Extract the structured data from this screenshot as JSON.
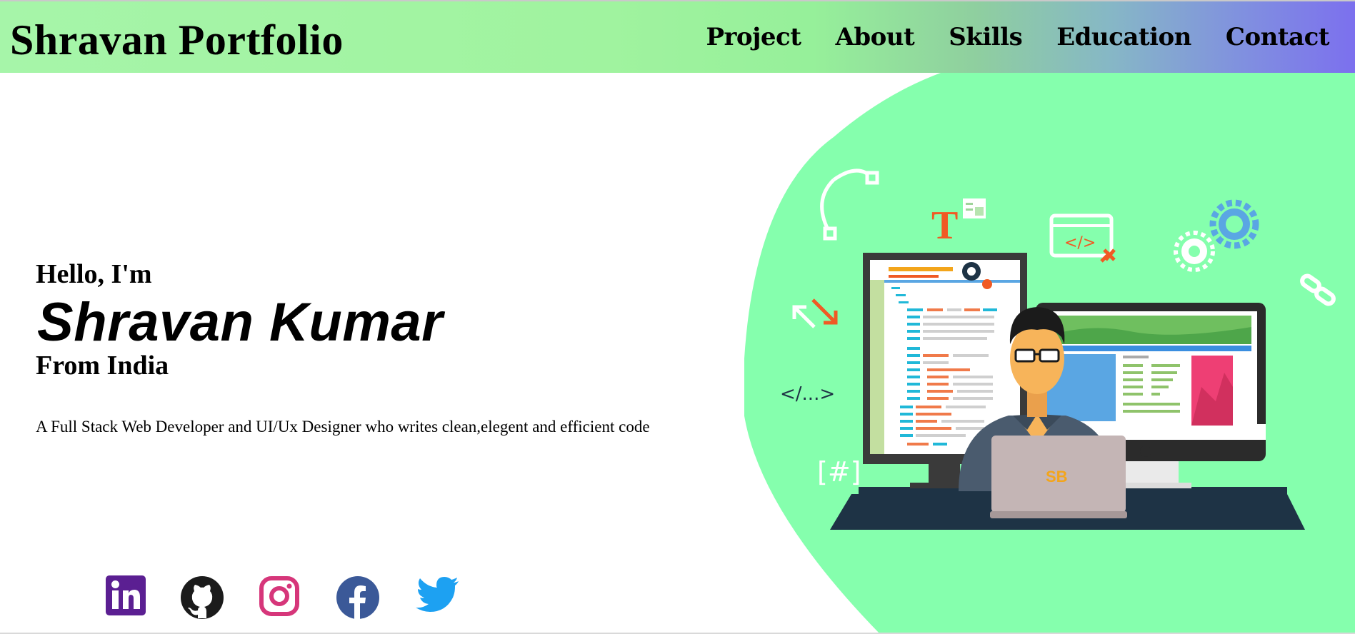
{
  "header": {
    "brand": "Shravan Portfolio",
    "nav": [
      "Project",
      "About",
      "Skills",
      "Education",
      "Contact"
    ]
  },
  "hero": {
    "greeting": "Hello, I'm",
    "name": "Shravan Kumar",
    "location": "From India",
    "description": "A Full Stack Web Developer and UI/Ux Designer who writes clean,elegent and efficient code",
    "illustration": {
      "code_tag": "</...>",
      "hash_tag": "[#]",
      "type_glyph": "T",
      "laptop_logo": "SB",
      "browser_code": "</>"
    }
  },
  "social": [
    {
      "name": "linkedin-icon",
      "color": "#5b1f92"
    },
    {
      "name": "github-icon",
      "color": "#1b1b1b"
    },
    {
      "name": "instagram-icon",
      "color": "#d6367a"
    },
    {
      "name": "facebook-icon",
      "color": "#3b5998"
    },
    {
      "name": "twitter-icon",
      "color": "#1da1f2"
    }
  ],
  "colors": {
    "accent_green": "#85ffad",
    "dark_navy": "#1e3345",
    "orange": "#f05a24"
  }
}
